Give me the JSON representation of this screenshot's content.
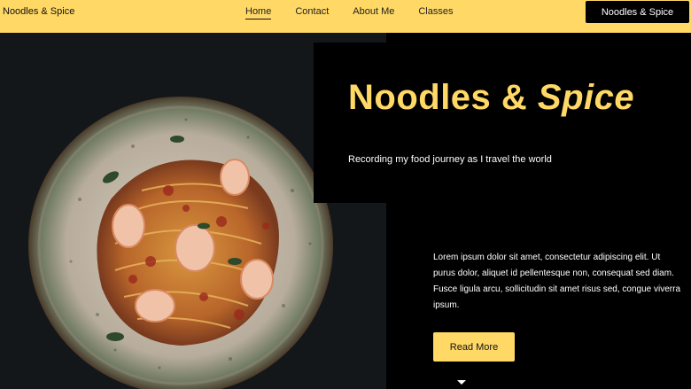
{
  "nav": {
    "brand": "Noodles & Spice",
    "links": [
      "Home",
      "Contact",
      "About Me",
      "Classes"
    ],
    "active": "Home",
    "cta_label": "Noodles & Spice"
  },
  "hero": {
    "title_main": "Noodles &",
    "title_accent": "Spice",
    "tagline": "Recording my food journey as I travel the world",
    "body": "Lorem ipsum dolor sit amet, consectetur adipiscing elit. Ut purus dolor, aliquet id pellentesque non, consequat sed diam. Fusce ligula arcu, sollicitudin sit amet risus sed, congue viverra ipsum.",
    "read_more_label": "Read More"
  },
  "colors": {
    "accent": "#ffd865",
    "dark": "#000000",
    "image_bg": "#14171a"
  },
  "icons": {
    "scroll": "chevron-down-icon"
  }
}
